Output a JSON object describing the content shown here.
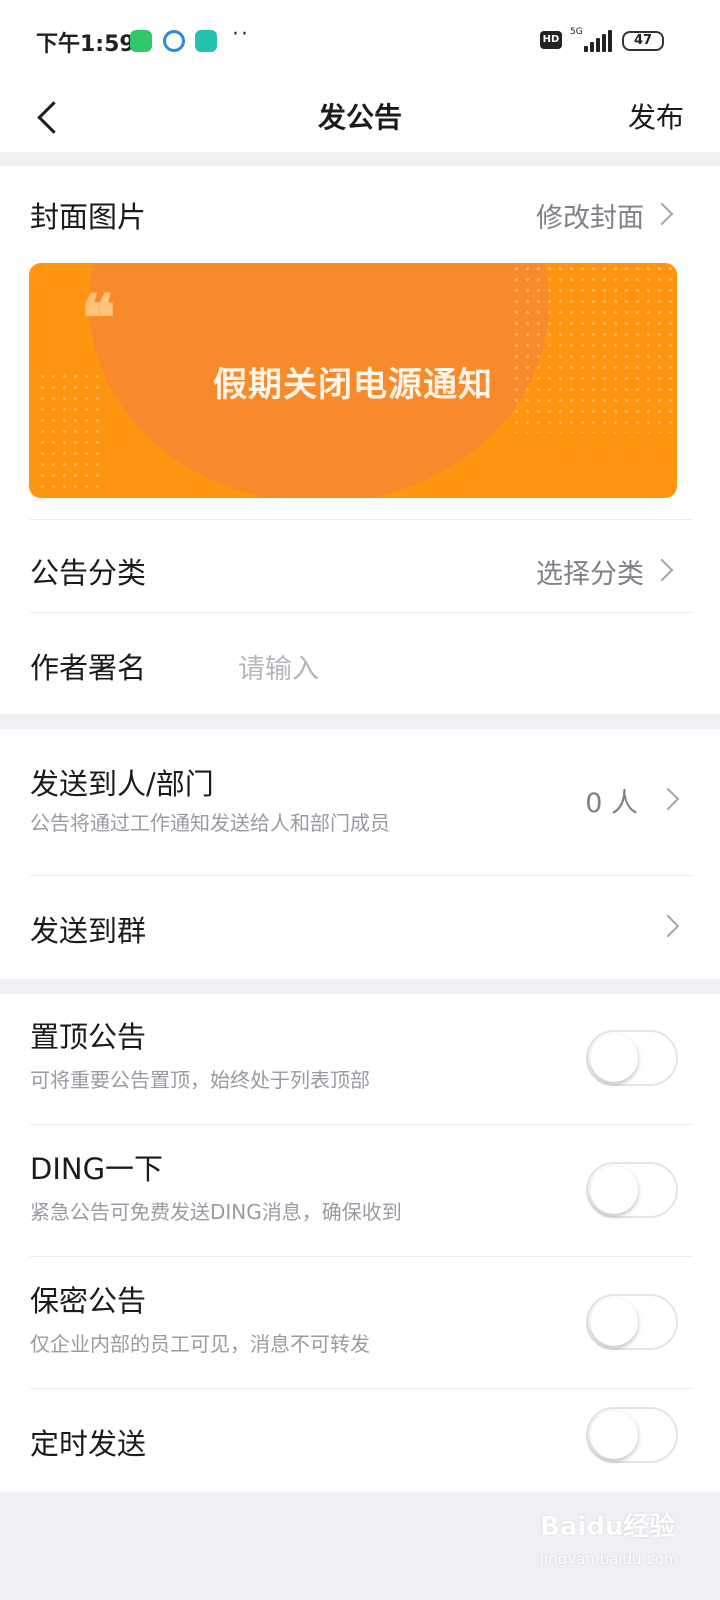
{
  "status_bar": {
    "time": "下午1:59",
    "dots": "··",
    "hd": "HD",
    "network": "5G",
    "battery": "47",
    "app_icons": [
      "wechat-icon",
      "edge-browser-icon",
      "video-app-icon"
    ]
  },
  "nav": {
    "title": "发公告",
    "publish_label": "发布"
  },
  "cover": {
    "label": "封面图片",
    "action_label": "修改封面",
    "banner_title": "假期关闭电源通知",
    "quote_mark": "❝"
  },
  "category": {
    "label": "公告分类",
    "action_label": "选择分类"
  },
  "author": {
    "label": "作者署名",
    "placeholder": "请输入"
  },
  "send_people": {
    "label": "发送到人/部门",
    "sublabel": "公告将通过工作通知发送给人和部门成员",
    "count": "0 人"
  },
  "send_group": {
    "label": "发送到群"
  },
  "toggles": [
    {
      "label": "置顶公告",
      "sublabel": "可将重要公告置顶，始终处于列表顶部",
      "on": false
    },
    {
      "label": "DING一下",
      "sublabel": "紧急公告可免费发送DING消息，确保收到",
      "on": false
    },
    {
      "label": "保密公告",
      "sublabel": "仅企业内部的员工可见，消息不可转发",
      "on": false
    },
    {
      "label": "定时发送",
      "sublabel": "",
      "on": false
    }
  ],
  "watermark": {
    "text": "Baidu经验",
    "sub": "jingyan.baidu.com"
  },
  "colors": {
    "cover_orange": "#ff9511",
    "page_bg": "#eff0f4",
    "text_primary": "#1b1b1f",
    "text_secondary": "#9a9ba2"
  }
}
